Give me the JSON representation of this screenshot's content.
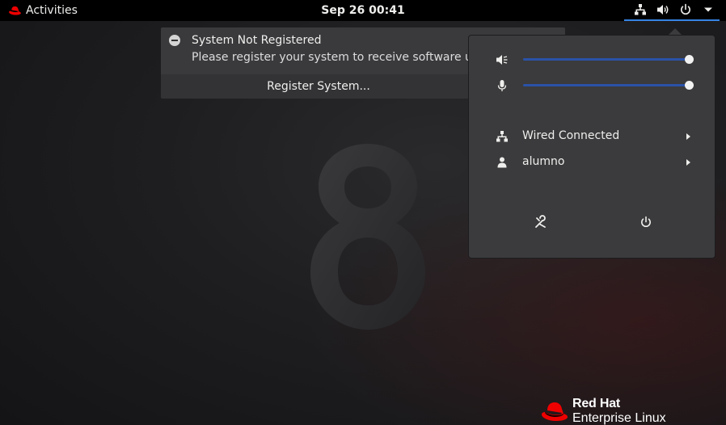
{
  "topbar": {
    "activities_label": "Activities",
    "clock": "Sep 26  00:41",
    "status_icons": [
      "network-wired-icon",
      "volume-icon",
      "power-icon",
      "chevron-down-icon"
    ]
  },
  "notification": {
    "icon": "minus-circle-icon",
    "title": "System Not Registered",
    "body": "Please register your system to receive software upda",
    "action_label": "Register System..."
  },
  "system_menu": {
    "output_volume": {
      "icon": "speaker-muted-icon",
      "level": 1.0
    },
    "input_volume": {
      "icon": "microphone-icon",
      "level": 1.0
    },
    "items": [
      {
        "icon": "network-wired-icon",
        "label": "Wired Connected",
        "has_submenu": true
      },
      {
        "icon": "user-icon",
        "label": "alumno",
        "has_submenu": true
      }
    ],
    "actions": [
      "settings-tools-icon",
      "power-icon"
    ]
  },
  "desktop": {
    "brand_line1": "Red Hat",
    "brand_line2": "Enterprise Linux",
    "wallpaper_numeral": "8"
  },
  "colors": {
    "accent": "#3584e4",
    "slider_track": "#2a52a8",
    "popup_bg": "#3b3b3d",
    "redhat_red": "#ee0000"
  }
}
